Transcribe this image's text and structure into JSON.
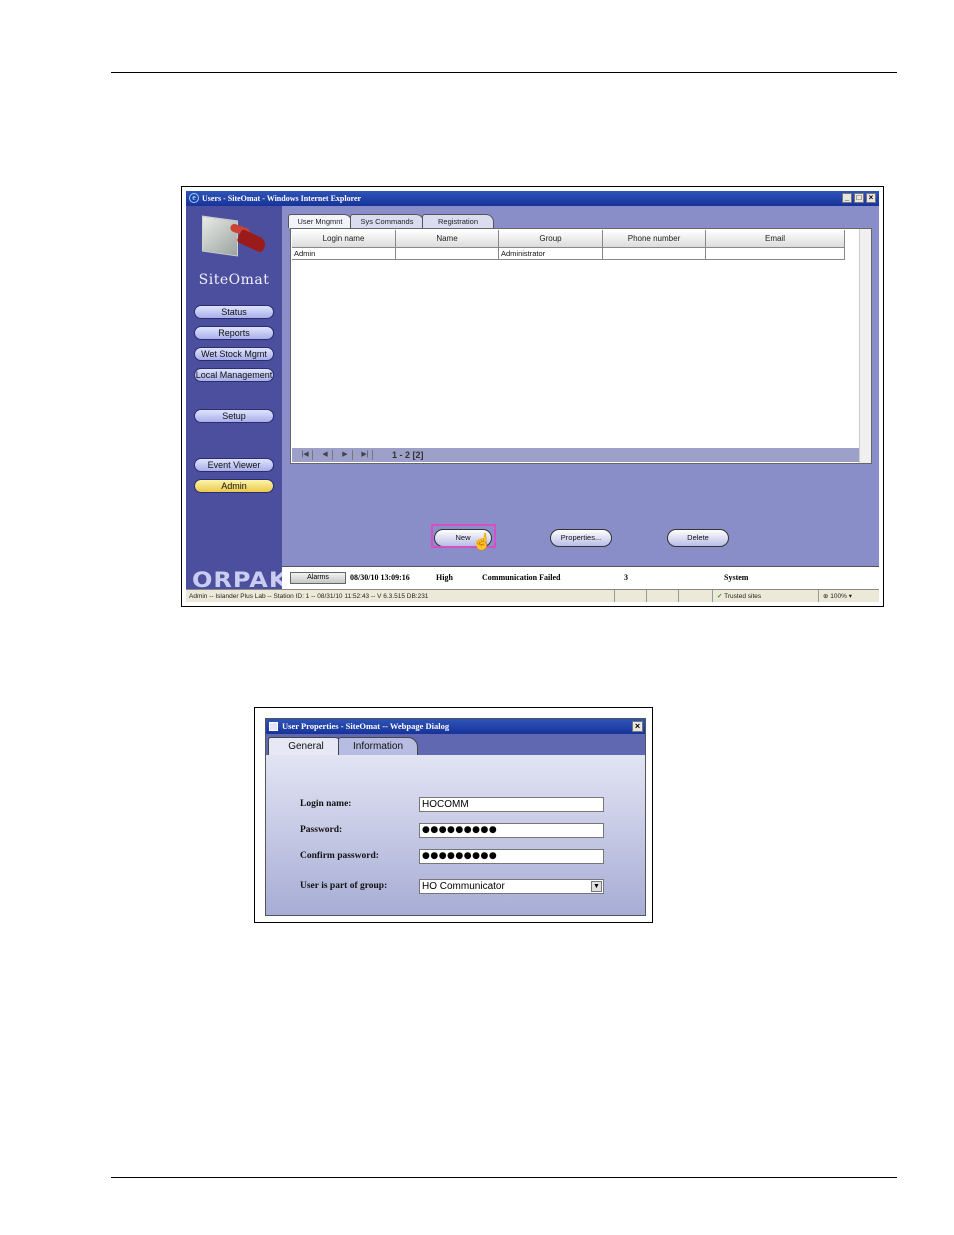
{
  "window": {
    "title": "Users - SiteOmat - Windows Internet Explorer",
    "controls": {
      "minimize": "_",
      "maximize": "□",
      "close": "×"
    }
  },
  "sidebar": {
    "brand": "SiteOmat",
    "nav": [
      "Status",
      "Reports",
      "Wet Stock Mgmt",
      "Local Management",
      "Setup",
      "Event Viewer",
      "Admin"
    ],
    "active": "Admin",
    "footer_logo": "ORPAK"
  },
  "tabs": [
    "User Mngmnt",
    "Sys Commands",
    "Registration"
  ],
  "users_table": {
    "columns": [
      "Login name",
      "Name",
      "Group",
      "Phone number",
      "Email"
    ],
    "rows": [
      [
        "Admin",
        "",
        "Administrator",
        "",
        ""
      ]
    ]
  },
  "pager": {
    "range": "1 - 2 [2]",
    "first": "|◀",
    "prev": "◀",
    "next": "▶",
    "last": "▶|"
  },
  "buttons": {
    "new": "New",
    "properties": "Properties...",
    "delete": "Delete"
  },
  "alarm_bar": {
    "button": "Alarms",
    "datetime": "08/30/10 13:09:16",
    "severity": "High",
    "message": "Communication Failed",
    "count": "3",
    "source": "System"
  },
  "statusbar": {
    "info": "Admin -- Islander Plus Lab -- Station ID: 1 -- 08/31/10 11:52:43 -- V 6.3.515 DB:231",
    "zone": "Trusted sites",
    "zoom": "100%"
  },
  "dialog": {
    "title": "User Properties - SiteOmat -- Webpage Dialog",
    "tabs": [
      "General",
      "Information"
    ],
    "labels": {
      "login": "Login name:",
      "password": "Password:",
      "confirm": "Confirm password:",
      "group": "User is part of group:"
    },
    "values": {
      "login": "HOCOMM",
      "password": "●●●●●●●●●",
      "confirm": "●●●●●●●●●",
      "group": "HO Communicator"
    }
  },
  "icons": [
    "ie-icon",
    "dialog-icon",
    "hand-cursor-icon",
    "dropdown-arrow-icon",
    "checkmark-icon",
    "zoom-icon"
  ]
}
